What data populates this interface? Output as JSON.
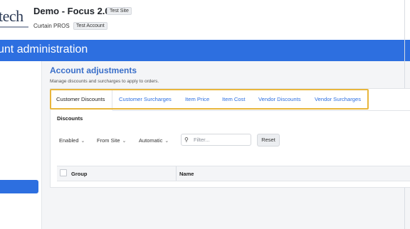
{
  "header": {
    "logo_text": "tech",
    "site_title": "Demo - Focus 2.0",
    "site_badge": "Test Site",
    "account_name": "Curtain PROS",
    "account_badge": "Test Account"
  },
  "banner": {
    "title": "unt administration"
  },
  "main": {
    "title": "Account adjustments",
    "subtitle": "Manage discounts and surcharges to apply to orders.",
    "tabs": [
      {
        "label": "Customer Discounts",
        "active": true
      },
      {
        "label": "Customer Surcharges",
        "active": false
      },
      {
        "label": "Item Price",
        "active": false
      },
      {
        "label": "Item Cost",
        "active": false
      },
      {
        "label": "Vendor Discounts",
        "active": false
      },
      {
        "label": "Vendor Surcharges",
        "active": false
      }
    ],
    "section_title": "Discounts",
    "filters": {
      "enabled": "Enabled",
      "site": "From Site",
      "mode": "Automatic",
      "search_placeholder": "Filter...",
      "reset_label": "Reset"
    },
    "table": {
      "columns": [
        "Group",
        "Name"
      ]
    }
  },
  "colors": {
    "accent": "#2d6fe0",
    "highlight_border": "#e8b63c",
    "title_blue": "#3a6fc9"
  },
  "icons": {
    "search": "search-icon",
    "chevron": "chevron-down-icon"
  }
}
